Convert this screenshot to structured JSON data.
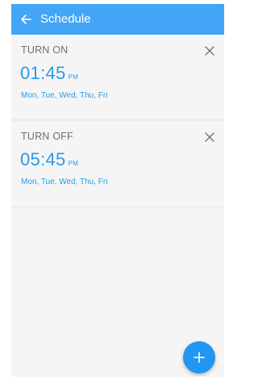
{
  "appbar": {
    "title": "Schedule"
  },
  "schedules": [
    {
      "mode": "TURN ON",
      "time": "01:45",
      "ampm": "PM",
      "days": "Mon, Tue, Wed, Thu, Fri"
    },
    {
      "mode": "TURN OFF",
      "time": "05:45",
      "ampm": "PM",
      "days": "Mon, Tue, Wed, Thu, Fri"
    }
  ],
  "colors": {
    "appbar": "#42a5f5",
    "accent": "#2b9be6",
    "fab": "#2196f3",
    "background": "#f5f5f5"
  },
  "icons": {
    "back": "arrow-left-icon",
    "close": "close-icon",
    "add": "plus-icon"
  }
}
